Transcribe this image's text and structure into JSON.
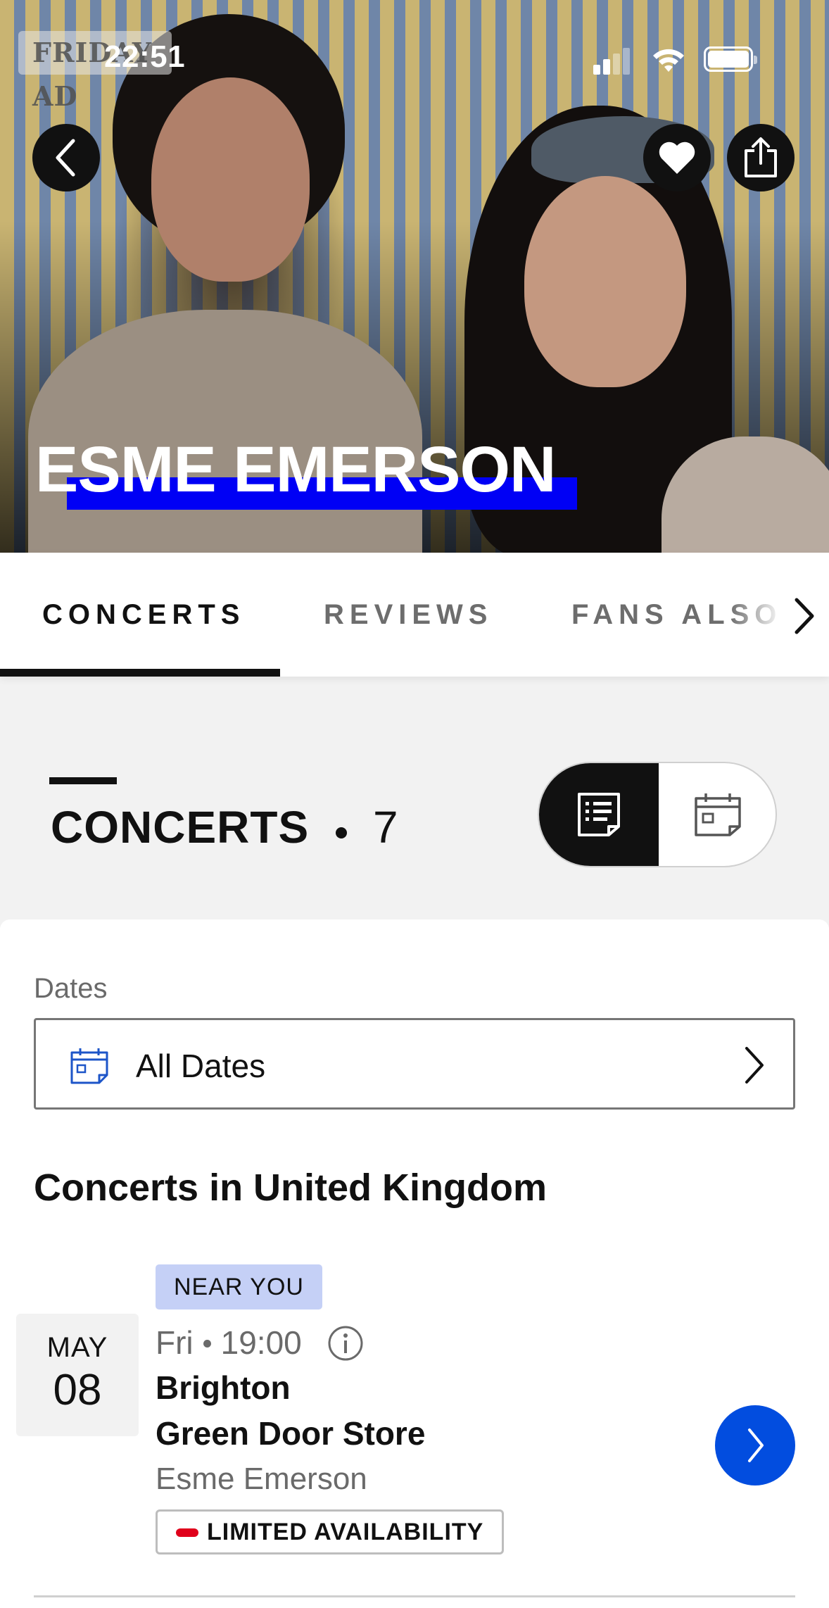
{
  "status_bar": {
    "time": "22:51",
    "ad_badge": "FRIDAY AD"
  },
  "hero": {
    "artist_name": "ESME EMERSON",
    "accent_color": "#0000f5"
  },
  "tabs": [
    {
      "label": "CONCERTS",
      "active": true
    },
    {
      "label": "REVIEWS",
      "active": false
    },
    {
      "label": "FANS ALSO",
      "active": false
    }
  ],
  "section": {
    "title": "CONCERTS",
    "count": "7",
    "view_modes": [
      "list-icon",
      "calendar-icon"
    ],
    "active_view": "list"
  },
  "filters": {
    "dates_label": "Dates",
    "dates_value": "All Dates"
  },
  "region_heading": "Concerts in United Kingdom",
  "concerts": [
    {
      "badge": "NEAR YOU",
      "month": "MAY",
      "day": "08",
      "weekday": "Fri",
      "time": "19:00",
      "city": "Brighton",
      "venue": "Green Door Store",
      "performer": "Esme Emerson",
      "availability": "LIMITED AVAILABILITY",
      "availability_color": "#e0001b"
    }
  ],
  "colors": {
    "primary_button": "#024ddf",
    "near_you_badge": "#c5d0f6"
  }
}
